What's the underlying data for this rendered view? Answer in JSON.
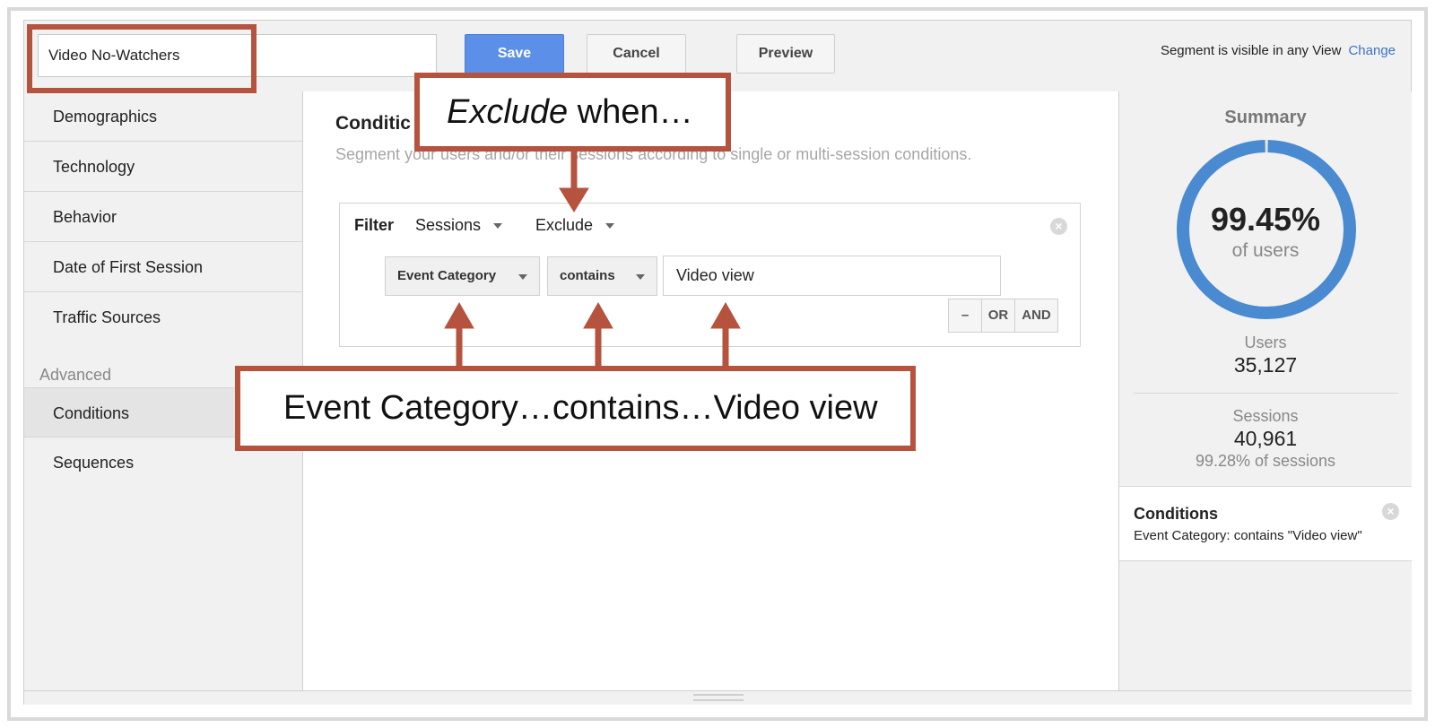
{
  "segment": {
    "name": "Video No-Watchers",
    "save_label": "Save",
    "cancel_label": "Cancel",
    "preview_label": "Preview",
    "visibility_text": "Segment is visible in any View",
    "change_label": "Change"
  },
  "sidebar": {
    "items": [
      {
        "label": "Demographics"
      },
      {
        "label": "Technology"
      },
      {
        "label": "Behavior"
      },
      {
        "label": "Date of First Session"
      },
      {
        "label": "Traffic Sources"
      }
    ],
    "advanced_label": "Advanced",
    "advanced_items": [
      {
        "label": "Conditions"
      },
      {
        "label": "Sequences"
      }
    ]
  },
  "main": {
    "title": "Conditic",
    "description": "Segment your users and/or their sessions according to single or multi-session conditions.",
    "filter": {
      "label": "Filter",
      "scope": "Sessions",
      "mode": "Exclude",
      "dimension": "Event Category",
      "operator": "contains",
      "value": "Video view",
      "logic_buttons": [
        "–",
        "OR",
        "AND"
      ]
    }
  },
  "summary": {
    "title": "Summary",
    "percent_label": "99.45%",
    "percent_value": 0.9945,
    "percent_sub": "of users",
    "users_label": "Users",
    "users_value": "35,127",
    "sessions_label": "Sessions",
    "sessions_value": "40,961",
    "sessions_pct": "99.28% of sessions",
    "conditions_title": "Conditions",
    "conditions_text": "Event Category: contains \"Video view\""
  },
  "annotations": {
    "exclude_italic": "Exclude",
    "exclude_rest": " when…",
    "event_text": "Event Category…contains…Video view"
  },
  "colors": {
    "accent": "#5b8fe8",
    "link": "#3b73c7",
    "donut": "#4a8ad0",
    "annotation": "#b5533e"
  }
}
